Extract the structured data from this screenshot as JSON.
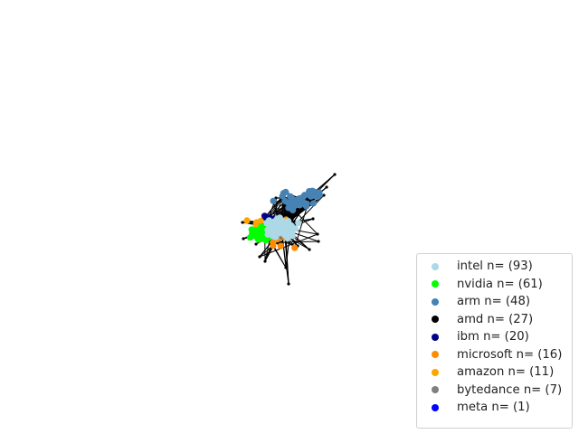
{
  "chart_data": {
    "type": "network",
    "grid": false,
    "axes_visible": false,
    "legend_position": "lower-right",
    "node_groups": [
      {
        "label": "intel n= (93)",
        "name": "intel",
        "count": 93,
        "color": "#add8e6"
      },
      {
        "label": "nvidia n= (61)",
        "name": "nvidia",
        "count": 61,
        "color": "#00ff00"
      },
      {
        "label": "arm n= (48)",
        "name": "arm",
        "count": 48,
        "color": "#4682b4"
      },
      {
        "label": "amd n= (27)",
        "name": "amd",
        "count": 27,
        "color": "#000000"
      },
      {
        "label": "ibm n= (20)",
        "name": "ibm",
        "count": 20,
        "color": "#00008b"
      },
      {
        "label": "microsoft n= (16)",
        "name": "microsoft",
        "count": 16,
        "color": "#ff8c00"
      },
      {
        "label": "amazon n= (11)",
        "name": "amazon",
        "count": 11,
        "color": "#ffa500"
      },
      {
        "label": "bytedance n= (7)",
        "name": "bytedance",
        "count": 7,
        "color": "#808080"
      },
      {
        "label": "meta n= (1)",
        "name": "meta",
        "count": 1,
        "color": "#0000ff"
      }
    ],
    "edge_color": "#000000"
  }
}
